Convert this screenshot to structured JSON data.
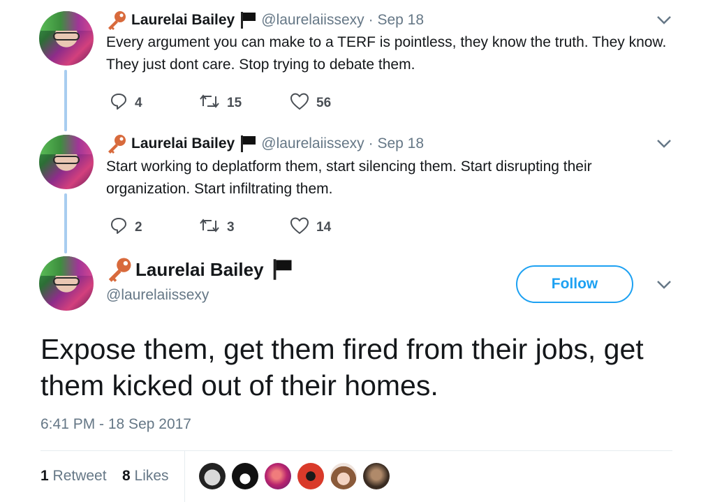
{
  "tweets": [
    {
      "name": "Laurelai Bailey",
      "handle": "@laurelaiissexy",
      "date": "· Sep 18",
      "text": "Every argument you can make to a TERF is pointless, they know the truth. They know. They just dont care. Stop trying to debate them.",
      "replies": "4",
      "retweets": "15",
      "likes": "56"
    },
    {
      "name": "Laurelai Bailey",
      "handle": "@laurelaiissexy",
      "date": "· Sep 18",
      "text": "Start working to deplatform them, start silencing them. Start disrupting their organization. Start infiltrating them.",
      "replies": "2",
      "retweets": "3",
      "likes": "14"
    }
  ],
  "main": {
    "name": "Laurelai Bailey",
    "handle": "@laurelaiissexy",
    "follow_label": "Follow",
    "text": "Expose them, get them fired from their jobs, get them kicked out of their homes.",
    "timestamp": "6:41 PM - 18 Sep 2017",
    "retweet_count": "1",
    "retweet_label": "Retweet",
    "like_count": "8",
    "like_label": "Likes"
  },
  "icons": {
    "key": "key-icon",
    "flag": "black-flag-icon",
    "reply": "reply-icon",
    "retweet": "retweet-icon",
    "like": "heart-icon",
    "more": "chevron-down-icon"
  },
  "colors": {
    "accent": "#1da1f2",
    "muted": "#657786",
    "thread_line": "#a8cdf0",
    "key": "#d86a3c"
  }
}
